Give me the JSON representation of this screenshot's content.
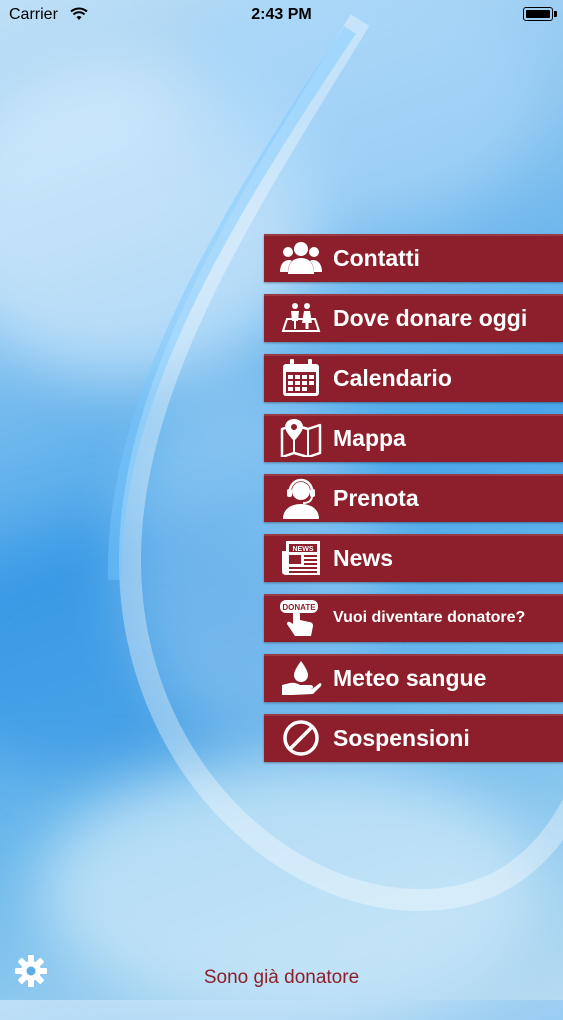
{
  "status_bar": {
    "carrier": "Carrier",
    "time": "2:43 PM"
  },
  "menu": {
    "items": [
      {
        "label": "Contatti",
        "icon": "people-group-icon"
      },
      {
        "label": "Dove donare oggi",
        "icon": "couple-location-icon"
      },
      {
        "label": "Calendario",
        "icon": "calendar-icon"
      },
      {
        "label": "Mappa",
        "icon": "map-pin-icon"
      },
      {
        "label": "Prenota",
        "icon": "headset-operator-icon"
      },
      {
        "label": "News",
        "icon": "newspaper-icon"
      },
      {
        "label": "Vuoi diventare donatore?",
        "icon": "donate-hand-icon"
      },
      {
        "label": "Meteo sangue",
        "icon": "blood-drop-hand-icon"
      },
      {
        "label": "Sospensioni",
        "icon": "prohibited-icon"
      }
    ]
  },
  "footer": {
    "link_label": "Sono già donatore",
    "settings_icon": "gear-icon"
  },
  "colors": {
    "menu_background": "#8c1f2b",
    "footer_link": "#8c1f2b"
  },
  "icon_texts": {
    "news": "NEWS",
    "donate": "DONATE"
  }
}
